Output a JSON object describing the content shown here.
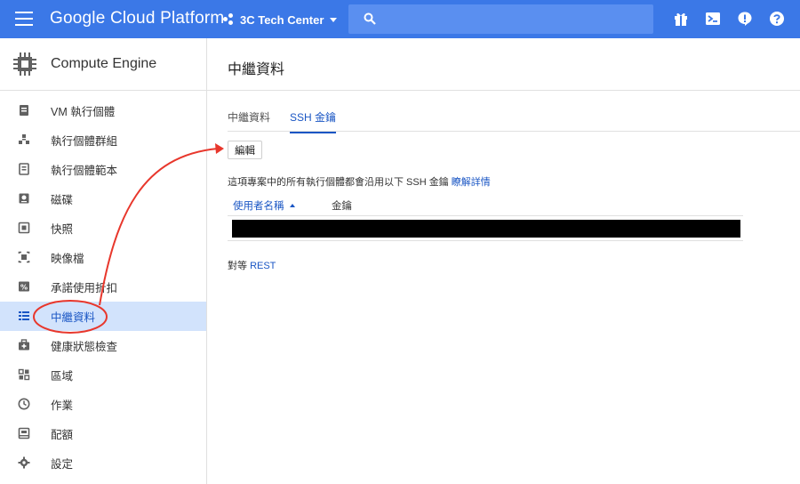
{
  "topbar": {
    "brand": "Google Cloud Platform",
    "project": "3C Tech Center",
    "icons": [
      "gift-icon",
      "cloud-shell-icon",
      "notifications-icon",
      "help-icon"
    ]
  },
  "sidebar": {
    "title": "Compute Engine",
    "items": [
      {
        "label": "VM 執行個體",
        "icon": "vm-instance-icon"
      },
      {
        "label": "執行個體群組",
        "icon": "instance-group-icon"
      },
      {
        "label": "執行個體範本",
        "icon": "instance-template-icon"
      },
      {
        "label": "磁碟",
        "icon": "disk-icon"
      },
      {
        "label": "快照",
        "icon": "snapshot-icon"
      },
      {
        "label": "映像檔",
        "icon": "image-icon"
      },
      {
        "label": "承諾使用折扣",
        "icon": "discount-icon"
      },
      {
        "label": "中繼資料",
        "icon": "metadata-icon"
      },
      {
        "label": "健康狀態檢查",
        "icon": "health-check-icon"
      },
      {
        "label": "區域",
        "icon": "zone-icon"
      },
      {
        "label": "作業",
        "icon": "operations-icon"
      },
      {
        "label": "配額",
        "icon": "quota-icon"
      },
      {
        "label": "設定",
        "icon": "settings-icon"
      }
    ],
    "active_index": 7
  },
  "main": {
    "title": "中繼資料",
    "tabs": [
      {
        "label": "中繼資料"
      },
      {
        "label": "SSH 金鑰"
      }
    ],
    "active_tab": 1,
    "edit_label": "編輯",
    "info_text": "這項專案中的所有執行個體都會沿用以下 SSH 金鑰 ",
    "info_link": "瞭解詳情",
    "columns": {
      "user": "使用者名稱",
      "key": "金鑰"
    },
    "equiv_text": "對等 ",
    "equiv_link": "REST"
  },
  "colors": {
    "accent": "#3b78e7",
    "link": "#1a56c4",
    "annotation": "#e8372c",
    "active_bg": "#d2e3fc"
  }
}
